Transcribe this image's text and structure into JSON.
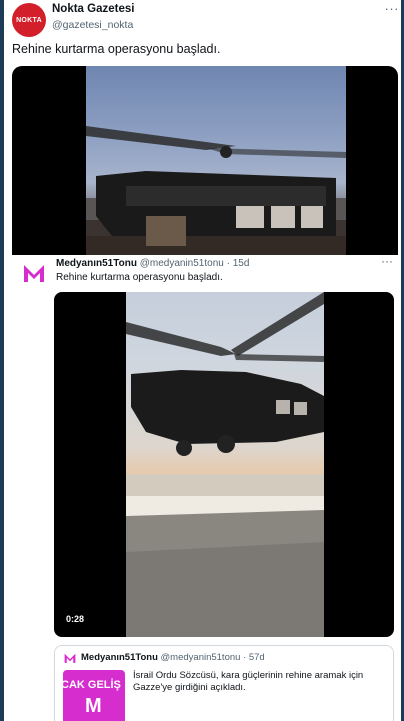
{
  "top_tweet": {
    "avatar_text": "NOKTA",
    "display_name": "Nokta Gazetesi",
    "handle": "@gazetesi_nokta",
    "more": "···",
    "text": "Rehine kurtarma operasyonu başladı."
  },
  "quoted_tweet": {
    "display_name": "Medyanın51Tonu",
    "handle_time": "@medyanin51tonu · 15d",
    "more": "···",
    "text": "Rehine kurtarma operasyonu başladı.",
    "video_duration": "0:28"
  },
  "nested_quote": {
    "display_name": "Medyanın51Tonu",
    "handle_time": "@medyanin51tonu · 57d",
    "thumb_text_1": "CAK GELİŞ",
    "thumb_text_2": "M",
    "text": "İsrail Ordu Sözcüsü, kara güçlerinin rehine aramak için Gazze'ye girdiğini açıkladı."
  },
  "colors": {
    "brand_red": "#d21f2a",
    "brand_magenta": "#d62dcf",
    "frame": "#1d3a57",
    "secondary_text": "#536471"
  }
}
